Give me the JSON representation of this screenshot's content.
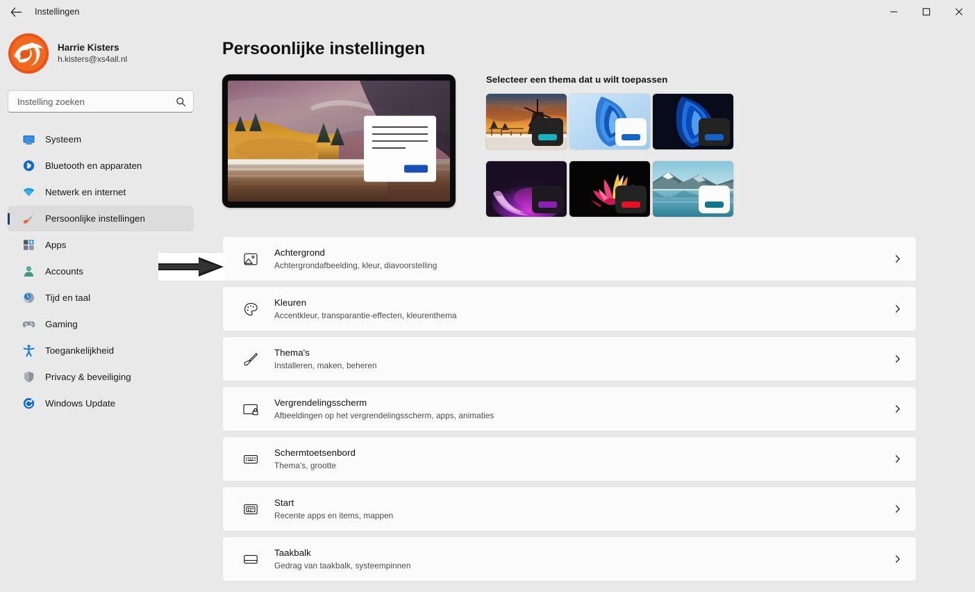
{
  "window": {
    "title": "Instellingen",
    "back_icon": "back-arrow-icon",
    "minimize_label": "—",
    "maximize_label": "□",
    "close_label": "✕"
  },
  "account": {
    "name": "Harrie Kisters",
    "email": "h.kisters@xs4all.nl",
    "avatar_icon": "user-avatar-logo"
  },
  "search": {
    "placeholder": "Instelling zoeken",
    "value": "",
    "icon": "search-icon"
  },
  "sidebar": {
    "items": [
      {
        "label": "Systeem",
        "icon": "monitor-icon",
        "selected": false
      },
      {
        "label": "Bluetooth en apparaten",
        "icon": "bluetooth-icon",
        "selected": false
      },
      {
        "label": "Netwerk en internet",
        "icon": "wifi-icon",
        "selected": false
      },
      {
        "label": "Persoonlijke instellingen",
        "icon": "paintbrush-icon",
        "selected": true
      },
      {
        "label": "Apps",
        "icon": "apps-grid-icon",
        "selected": false
      },
      {
        "label": "Accounts",
        "icon": "person-icon",
        "selected": false
      },
      {
        "label": "Tijd en taal",
        "icon": "clock-globe-icon",
        "selected": false
      },
      {
        "label": "Gaming",
        "icon": "gamepad-icon",
        "selected": false
      },
      {
        "label": "Toegankelijkheid",
        "icon": "accessibility-icon",
        "selected": false
      },
      {
        "label": "Privacy & beveiliging",
        "icon": "shield-icon",
        "selected": false
      },
      {
        "label": "Windows Update",
        "icon": "update-refresh-icon",
        "selected": false
      }
    ]
  },
  "main": {
    "page_title": "Persoonlijke instellingen",
    "preview": {
      "icon": "desktop-preview",
      "wallpaper_description": "Autumn lake landscape",
      "dialog_accent": "#1a50b4"
    },
    "themes": {
      "heading": "Selecteer een thema dat u wilt toepassen",
      "tiles": [
        {
          "name": "Windmolen bij zonsondergang",
          "mode": "dark",
          "swatch_bg": "#232323",
          "accent": "#18b3c0"
        },
        {
          "name": "Windows Bloom licht",
          "mode": "light",
          "swatch_bg": "#fbfbfb",
          "accent": "#1464c8"
        },
        {
          "name": "Windows Bloom donker",
          "mode": "dark",
          "swatch_bg": "#232323",
          "accent": "#1464c8"
        },
        {
          "name": "Paarse gloed",
          "mode": "dark",
          "swatch_bg": "#1e1820",
          "accent": "#8b1fb4"
        },
        {
          "name": "Kleurrijke bloem",
          "mode": "dark",
          "swatch_bg": "#232323",
          "accent": "#e81123"
        },
        {
          "name": "Bergmeer",
          "mode": "light",
          "swatch_bg": "#fbfbfb",
          "accent": "#10788c"
        }
      ]
    },
    "settings_list": [
      {
        "title": "Achtergrond",
        "subtitle": "Achtergrondafbeelding, kleur, diavoorstelling",
        "icon": "image-icon",
        "chevron": "chevron-right-icon"
      },
      {
        "title": "Kleuren",
        "subtitle": "Accentkleur, transparantie-effecten, kleurenthema",
        "icon": "palette-icon",
        "chevron": "chevron-right-icon"
      },
      {
        "title": "Thema's",
        "subtitle": "Installeren, maken, beheren",
        "icon": "paintbrush-icon",
        "chevron": "chevron-right-icon"
      },
      {
        "title": "Vergrendelingsscherm",
        "subtitle": "Afbeeldingen op het vergrendelingsscherm, apps, animaties",
        "icon": "lock-screen-icon",
        "chevron": "chevron-right-icon"
      },
      {
        "title": "Schermtoetsenbord",
        "subtitle": "Thema's, grootte",
        "icon": "keyboard-icon",
        "chevron": "chevron-right-icon"
      },
      {
        "title": "Start",
        "subtitle": "Recente apps en items, mappen",
        "icon": "start-menu-icon",
        "chevron": "chevron-right-icon"
      },
      {
        "title": "Taakbalk",
        "subtitle": "Gedrag van taakbalk, systeempinnen",
        "icon": "taskbar-icon",
        "chevron": "chevron-right-icon"
      }
    ]
  },
  "annotation": {
    "arrow_icon": "pointing-arrow-icon",
    "points_at": "Achtergrond"
  },
  "colors": {
    "window_bg": "#e9e9e9",
    "card_bg": "#fbfbfb",
    "selection_bg": "#dcdcdc",
    "accent_indicator": "#0f3aa8",
    "text_primary": "#111111",
    "text_secondary": "#4a4a4a"
  }
}
